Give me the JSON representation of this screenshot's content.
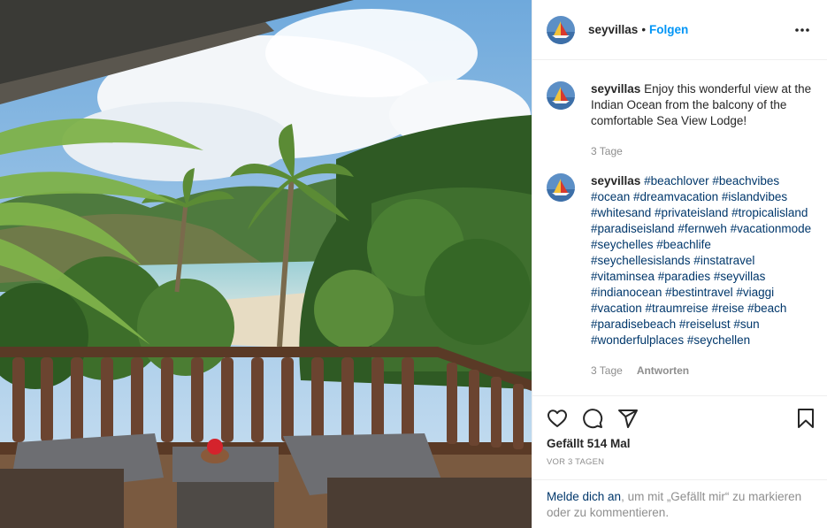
{
  "post": {
    "username": "seyvillas",
    "follow_label": "Folgen",
    "separator": "•"
  },
  "caption": {
    "username": "seyvillas",
    "text": "Enjoy this wonderful view at the Indian Ocean from the balcony of the comfortable Sea View Lodge!",
    "time": "3 Tage"
  },
  "comment": {
    "username": "seyvillas",
    "hashtags": "#beachlover #beachvibes #ocean #dreamvacation #islandvibes #whitesand #privateisland #tropicalisland #paradiseisland #fernweh #vacationmode #seychelles #beachlife #seychellesislands #instatravel #vitaminsea #paradies #seyvillas #indianocean #bestintravel #viaggi #vacation #traumreise #reise #beach #paradisebeach #reiselust #sun #wonderfulplaces #seychellen",
    "time": "3 Tage",
    "reply_label": "Antworten"
  },
  "stats": {
    "likes": "Gefällt 514 Mal",
    "date": "VOR 3 TAGEN"
  },
  "login_prompt": {
    "link": "Melde dich an",
    "rest": ", um mit „Gefällt mir“ zu markieren oder zu kommentieren."
  },
  "icons": {
    "more": "more-horizontal-icon",
    "like": "heart-icon",
    "comment": "comment-icon",
    "share": "paper-plane-icon",
    "save": "bookmark-icon"
  },
  "colors": {
    "follow": "#0095f6",
    "hashtag": "#00376b",
    "muted": "#8e8e8e"
  }
}
